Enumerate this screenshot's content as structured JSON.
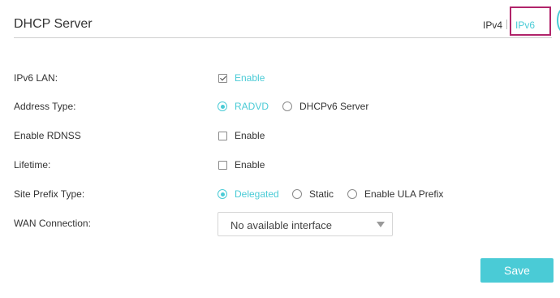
{
  "header": {
    "title": "DHCP Server",
    "tabs": [
      {
        "label": "IPv4",
        "active": false
      },
      {
        "label": "IPv6",
        "active": true
      }
    ]
  },
  "form": {
    "ipv6_lan": {
      "label": "IPv6 LAN:",
      "option": "Enable",
      "checked": true
    },
    "address_type": {
      "label": "Address Type:",
      "options": [
        {
          "label": "RADVD",
          "selected": true
        },
        {
          "label": "DHCPv6 Server",
          "selected": false
        }
      ]
    },
    "enable_rdnss": {
      "label": "Enable RDNSS",
      "option": "Enable",
      "checked": false
    },
    "lifetime": {
      "label": "Lifetime:",
      "option": "Enable",
      "checked": false
    },
    "site_prefix_type": {
      "label": "Site Prefix Type:",
      "options": [
        {
          "label": "Delegated",
          "selected": true
        },
        {
          "label": "Static",
          "selected": false
        },
        {
          "label": "Enable ULA Prefix",
          "selected": false
        }
      ]
    },
    "wan_connection": {
      "label": "WAN Connection:",
      "value": "No available interface"
    }
  },
  "actions": {
    "save_label": "Save"
  },
  "colors": {
    "accent": "#4acbd6",
    "highlight": "#b1246a",
    "text": "#333333"
  }
}
